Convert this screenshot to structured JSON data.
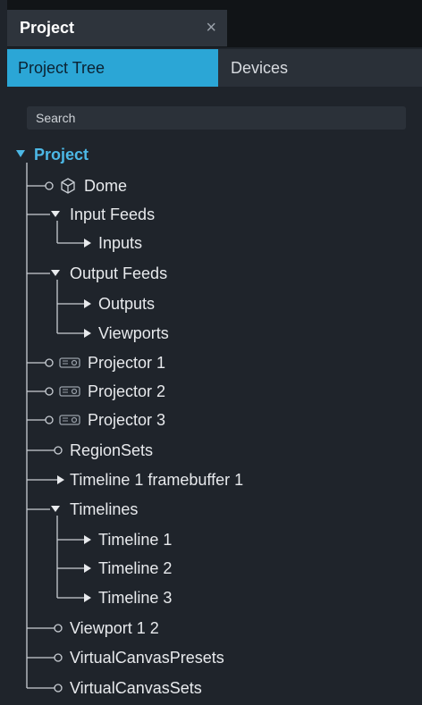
{
  "panel": {
    "tab_title": "Project",
    "close_glyph": "×"
  },
  "subtabs": [
    {
      "label": "Project Tree",
      "active": true
    },
    {
      "label": "Devices",
      "active": false
    }
  ],
  "search": {
    "placeholder": "Search",
    "value": ""
  },
  "tree": {
    "root": {
      "label": "Project",
      "expanded": true
    },
    "items": [
      {
        "label": "Dome",
        "icon": "dome-icon",
        "connector": "circle"
      },
      {
        "label": "Input Feeds",
        "connector": "expanded-caret"
      },
      {
        "label": "Inputs",
        "connector": "collapsed-arrow",
        "child": true
      },
      {
        "label": "Output Feeds",
        "connector": "expanded-caret"
      },
      {
        "label": "Outputs",
        "connector": "collapsed-arrow",
        "child": true
      },
      {
        "label": "Viewports",
        "connector": "collapsed-arrow",
        "child": true
      },
      {
        "label": "Projector 1",
        "icon": "projector-icon",
        "connector": "circle"
      },
      {
        "label": "Projector 2",
        "icon": "projector-icon",
        "connector": "circle"
      },
      {
        "label": "Projector 3",
        "icon": "projector-icon",
        "connector": "circle"
      },
      {
        "label": "RegionSets",
        "connector": "circle"
      },
      {
        "label": "Timeline 1 framebuffer 1",
        "connector": "collapsed-arrow"
      },
      {
        "label": "Timelines",
        "connector": "expanded-caret"
      },
      {
        "label": "Timeline 1",
        "connector": "collapsed-arrow",
        "child": true
      },
      {
        "label": "Timeline 2",
        "connector": "collapsed-arrow",
        "child": true
      },
      {
        "label": "Timeline 3",
        "connector": "collapsed-arrow",
        "child": true
      },
      {
        "label": "Viewport 1 2",
        "connector": "circle"
      },
      {
        "label": "VirtualCanvasPresets",
        "connector": "circle"
      },
      {
        "label": "VirtualCanvasSets",
        "connector": "circle"
      }
    ]
  },
  "colors": {
    "accent": "#2ba6d6",
    "root_label": "#4cb8e6",
    "background": "#1f242b"
  }
}
